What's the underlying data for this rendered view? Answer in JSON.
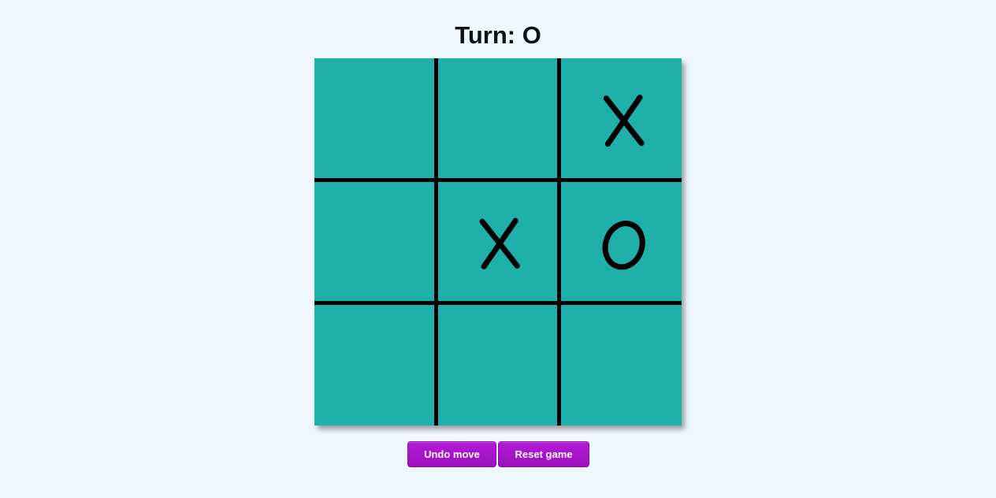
{
  "header": {
    "turn_label": "Turn: O"
  },
  "board": {
    "cells": [
      [
        "",
        "",
        "X"
      ],
      [
        "",
        "X",
        "O"
      ],
      [
        "",
        "",
        ""
      ]
    ],
    "colors": {
      "board_bg": "#20b0aa",
      "grid_line": "#000000",
      "mark": "#000000"
    }
  },
  "controls": {
    "undo_label": "Undo move",
    "reset_label": "Reset game",
    "button_color": "#a915cc"
  }
}
